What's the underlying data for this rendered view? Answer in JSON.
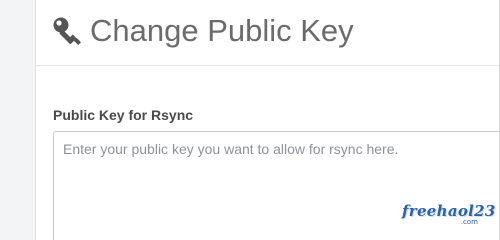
{
  "header": {
    "title": "Change Public Key",
    "icon": "key-icon"
  },
  "form": {
    "public_key": {
      "label": "Public Key for Rsync",
      "value": "",
      "placeholder": "Enter your public key you want to allow for rsync here."
    }
  },
  "watermark": {
    "text": "freehaol23",
    "suffix": ".com"
  },
  "colors": {
    "title": "#6b6b6b",
    "label": "#4a4a4a",
    "placeholder": "#8e9297",
    "border": "#c9cdd2",
    "rail": "#f3f4f6",
    "watermark": "#2b5fb3"
  }
}
